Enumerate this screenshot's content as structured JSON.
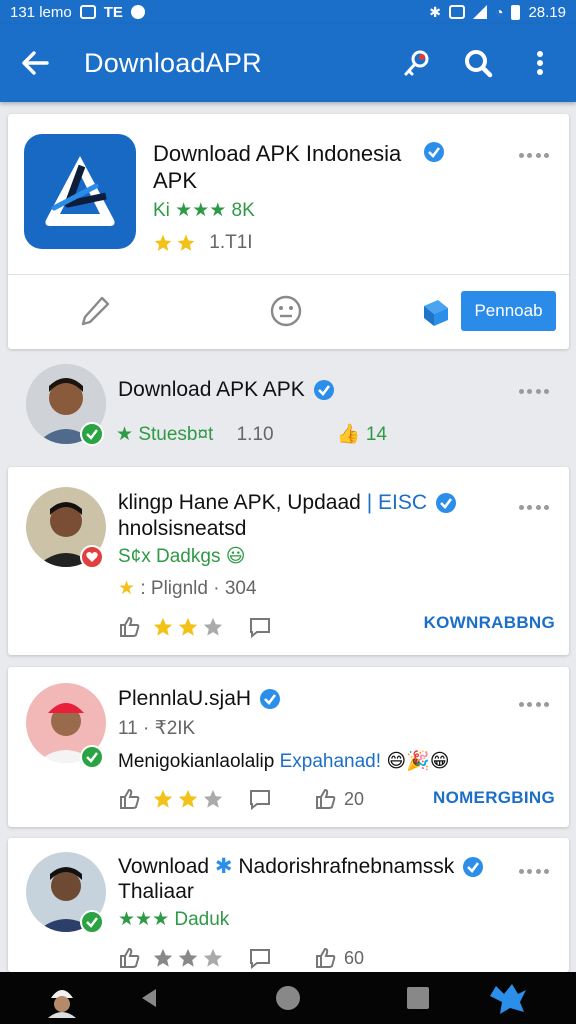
{
  "status_bar": {
    "time_left": "131 lemo",
    "icon_text": "TE",
    "battery_text": "28.19"
  },
  "app_bar": {
    "title": "DownloadAPR"
  },
  "featured": {
    "title_line1": "Download APK Indonesia",
    "title_line2": "APK",
    "rating_text": "Ki ★★★ 8K",
    "downloads_text": "1.T1I",
    "button_label": "Pennoab"
  },
  "posts": [
    {
      "name": "Download  APK APK",
      "line1_label": "Stuesb¤t",
      "line1_count": "1.10",
      "line1_likes": "14"
    },
    {
      "name": "klingp Hane APK, Updaad",
      "name_suffix": "EISC",
      "sub": "hnolsisneatsd",
      "line2": "S¢x Dadkgs",
      "line3": "Plignld · 304",
      "action": "KOWNRABBNG"
    },
    {
      "name": "PlennlaU.sjaH",
      "sub": "11 · ₹2IK",
      "line2_a": "Menigokianlaolalip",
      "line2_b": "Expahanad!",
      "likes": "20",
      "action": "NOMERGBING"
    },
    {
      "name_a": "Vownload",
      "name_b": "Nadorishrafnebnamssk",
      "sub": "Thaliaar",
      "line2": "★★★ Daduk",
      "likes": "60"
    }
  ],
  "colors": {
    "primary": "#1b6fc9",
    "green": "#2f9a45",
    "star": "#f3c218",
    "background": "#e9eaee"
  }
}
